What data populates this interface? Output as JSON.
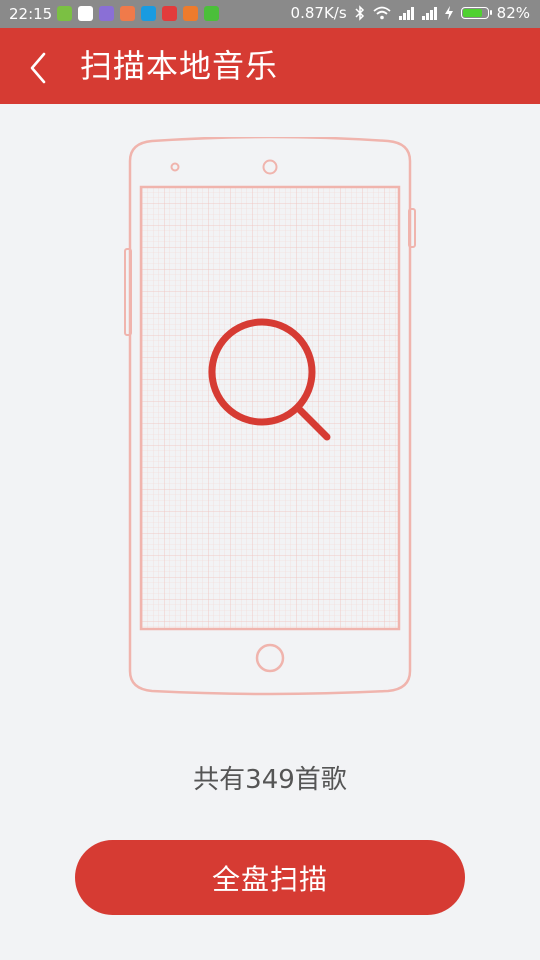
{
  "status_bar": {
    "time": "22:15",
    "network_speed": "0.87K/s",
    "battery_percent": "82%",
    "battery_level": 0.82,
    "notification_icons": [
      {
        "name": "sim-app-icon",
        "color": "#7bc043"
      },
      {
        "name": "qq-icon",
        "color": "#ffffff"
      },
      {
        "name": "purple-app-icon",
        "color": "#8a6fd6"
      },
      {
        "name": "orange-app-icon",
        "color": "#f07a4a"
      },
      {
        "name": "blue-app-icon",
        "color": "#1a9be0"
      },
      {
        "name": "alarm-app-icon",
        "color": "#e23b3b"
      },
      {
        "name": "weibo-app-icon",
        "color": "#ee7b2c"
      },
      {
        "name": "green-app-icon",
        "color": "#4bbf3a"
      }
    ]
  },
  "header": {
    "title": "扫描本地音乐",
    "back_icon": "chevron-left-icon"
  },
  "main": {
    "illustration_icon": "search-icon",
    "song_count_text": "共有349首歌",
    "scan_button_label": "全盘扫描"
  },
  "colors": {
    "accent": "#d63b33",
    "background": "#f2f3f5",
    "phone_outline": "#f0b4ad",
    "grid_line": "#f3cfcb"
  }
}
